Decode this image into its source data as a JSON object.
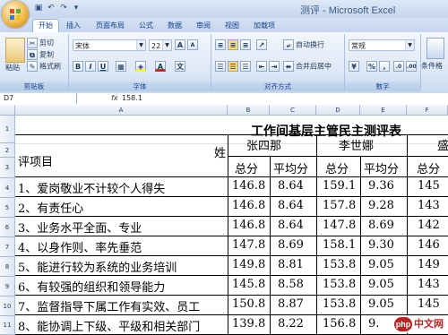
{
  "window": {
    "title": "测评 - Microsoft Excel"
  },
  "quick_access": [
    "save-icon",
    "undo-icon",
    "redo-icon",
    "customize-icon"
  ],
  "tabs": [
    "开始",
    "插入",
    "页面布局",
    "公式",
    "数据",
    "审阅",
    "视图",
    "加载项"
  ],
  "ribbon": {
    "clipboard": {
      "paste": "粘贴",
      "cut": "剪切",
      "copy": "复制",
      "format_painter": "格式刷",
      "label": "剪贴板"
    },
    "font": {
      "name": "宋体",
      "size": "22",
      "label": "字体",
      "bold": "B",
      "italic": "I",
      "underline": "U"
    },
    "alignment": {
      "wrap": "自动换行",
      "merge": "合并后居中",
      "label": "对齐方式"
    },
    "number": {
      "format": "常规",
      "percent": "%",
      "comma": ",",
      "label": "数字"
    },
    "styles": {
      "conditional": "条件格"
    }
  },
  "formula_bar": {
    "name_box": "D7",
    "fx": "fx",
    "value": "158.1"
  },
  "columns": [
    "A",
    "B",
    "C",
    "D",
    "E",
    "F"
  ],
  "rows": [
    "1",
    "2",
    "3",
    "4",
    "5",
    "6",
    "7",
    "8",
    "9",
    "10",
    "11"
  ],
  "sheet": {
    "title": "工作间基层主管民主测评表",
    "header_item": "评项目",
    "header_name_suffix": "姓",
    "names": [
      "张四那",
      "李世娜",
      "盛"
    ],
    "sub_headers": [
      "总分",
      "平均分",
      "总分",
      "平均分",
      "总分"
    ],
    "items": [
      {
        "label": "1、爱岗敬业不计较个人得失",
        "v": [
          "146.8",
          "8.64",
          "159.1",
          "9.36",
          "145"
        ]
      },
      {
        "label": "2、有责任心",
        "v": [
          "146.8",
          "8.64",
          "157.8",
          "9.28",
          "143"
        ]
      },
      {
        "label": "3、业务水平全面、专业",
        "v": [
          "146.8",
          "8.64",
          "147.8",
          "8.69",
          "142"
        ]
      },
      {
        "label": "4、以身作则、率先垂范",
        "v": [
          "147.8",
          "8.69",
          "158.1",
          "9.30",
          "146"
        ]
      },
      {
        "label": "5、能进行较为系统的业务培训",
        "v": [
          "149.8",
          "8.81",
          "153.8",
          "9.05",
          "149"
        ]
      },
      {
        "label": "6、有较强的组织和领导能力",
        "v": [
          "145.8",
          "8.58",
          "153.8",
          "9.05",
          "143"
        ]
      },
      {
        "label": "7、监督指导下属工作有实效、员工",
        "v": [
          "150.8",
          "8.87",
          "153.8",
          "9.05",
          "145"
        ]
      },
      {
        "label": "8、能协调上下级、平级和相关部门",
        "v": [
          "139.8",
          "8.22",
          "156.8",
          "9.",
          ""
        ]
      }
    ]
  },
  "watermark": {
    "badge": "php",
    "text": "中文网"
  }
}
